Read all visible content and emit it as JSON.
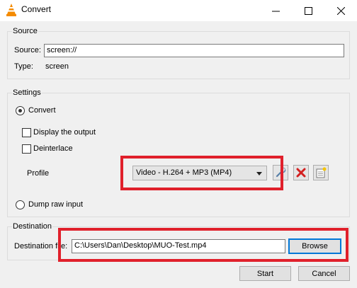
{
  "window": {
    "title": "Convert"
  },
  "source": {
    "legend": "Source",
    "source_label": "Source:",
    "source_value": "screen://",
    "type_label": "Type:",
    "type_value": "screen"
  },
  "settings": {
    "legend": "Settings",
    "convert_label": "Convert",
    "display_output_label": "Display the output",
    "deinterlace_label": "Deinterlace",
    "profile_label": "Profile",
    "profile_value": "Video - H.264 + MP3 (MP4)",
    "dump_raw_label": "Dump raw input"
  },
  "destination": {
    "legend": "Destination",
    "file_label": "Destination file:",
    "file_value": "C:\\Users\\Dan\\Desktop\\MUO-Test.mp4",
    "browse_label": "Browse"
  },
  "footer": {
    "start_label": "Start",
    "cancel_label": "Cancel"
  },
  "colors": {
    "highlight": "#e0202b",
    "accent": "#0078d7"
  }
}
